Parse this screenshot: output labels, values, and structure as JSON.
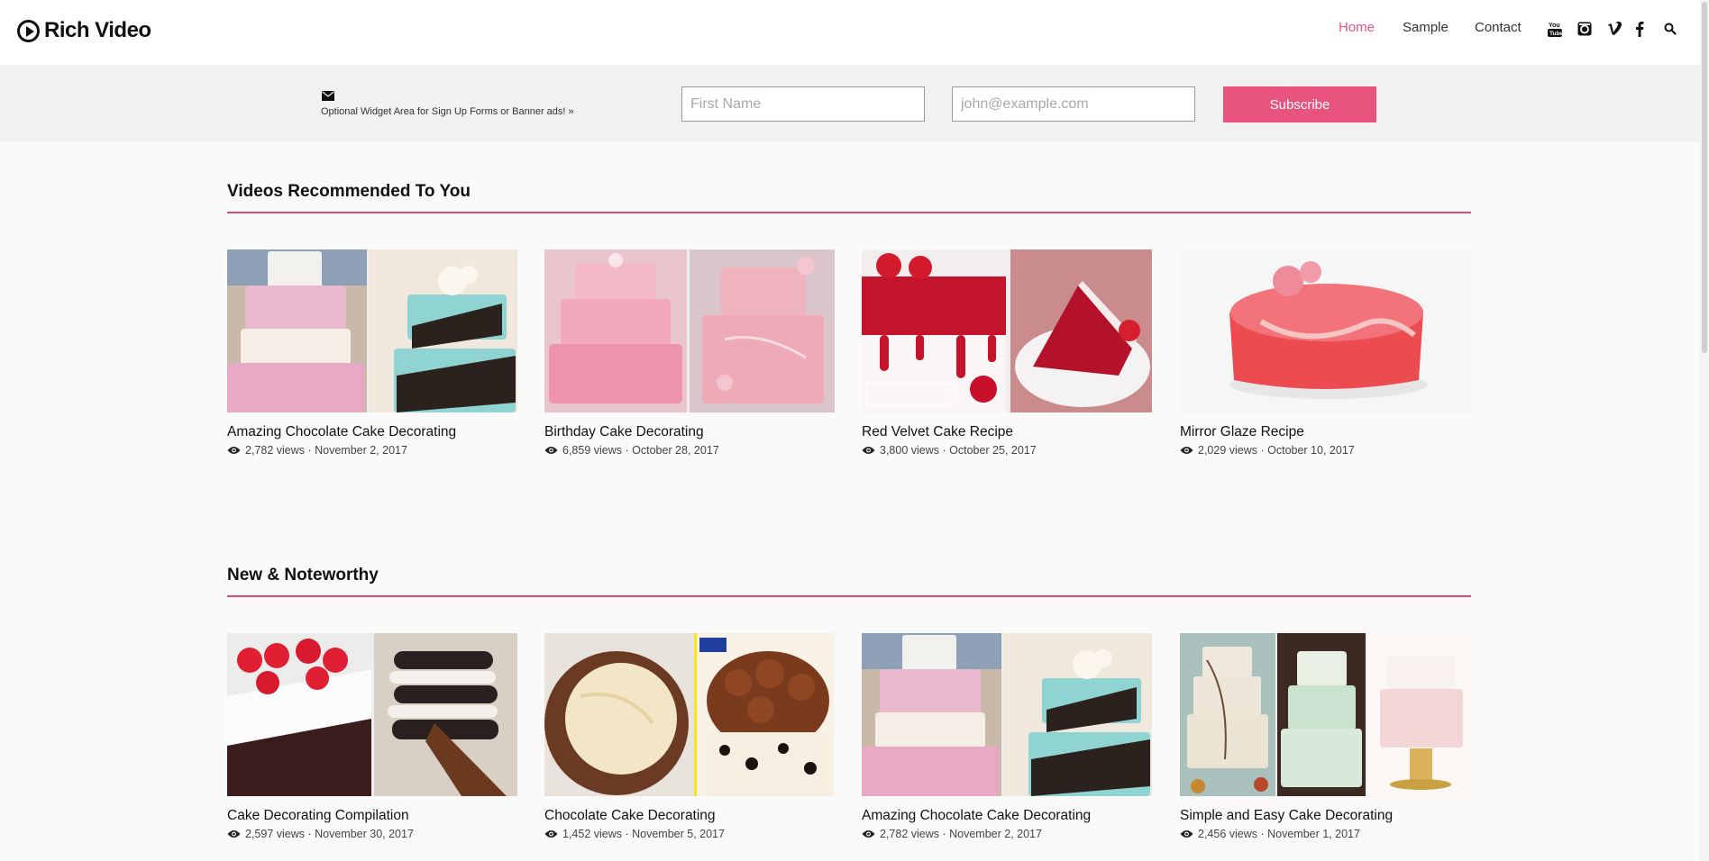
{
  "header": {
    "logo_text": "Rich Video",
    "nav": [
      {
        "label": "Home",
        "active": true
      },
      {
        "label": "Sample",
        "active": false
      },
      {
        "label": "Contact",
        "active": false
      }
    ],
    "social_icons": [
      "youtube-icon",
      "instagram-icon",
      "vimeo-icon",
      "facebook-icon",
      "search-icon"
    ]
  },
  "banner": {
    "icon": "envelope-icon",
    "text": "Optional Widget Area for Sign Up Forms or Banner ads! »",
    "first_name_placeholder": "First Name",
    "email_placeholder": "john@example.com",
    "subscribe_label": "Subscribe"
  },
  "sections": [
    {
      "title": "Videos Recommended To You",
      "cards": [
        {
          "title": "Amazing Chocolate Cake Decorating",
          "views": "2,782 views",
          "date": "November 2, 2017"
        },
        {
          "title": "Birthday Cake Decorating",
          "views": "6,859 views",
          "date": "October 28, 2017"
        },
        {
          "title": "Red Velvet Cake Recipe",
          "views": "3,800 views",
          "date": "October 25, 2017"
        },
        {
          "title": "Mirror Glaze Recipe",
          "views": "2,029 views",
          "date": "October 10, 2017"
        }
      ]
    },
    {
      "title": "New & Noteworthy",
      "cards": [
        {
          "title": "Cake Decorating Compilation",
          "views": "2,597 views",
          "date": "November 30, 2017"
        },
        {
          "title": "Chocolate Cake Decorating",
          "views": "1,452 views",
          "date": "November 5, 2017"
        },
        {
          "title": "Amazing Chocolate Cake Decorating",
          "views": "2,782 views",
          "date": "November 2, 2017"
        },
        {
          "title": "Simple and Easy Cake Decorating",
          "views": "2,456 views",
          "date": "November 1, 2017"
        }
      ]
    }
  ],
  "colors": {
    "accent": "#e8547d",
    "rule": "#d94d74",
    "banner_bg": "#f1f1f1"
  }
}
